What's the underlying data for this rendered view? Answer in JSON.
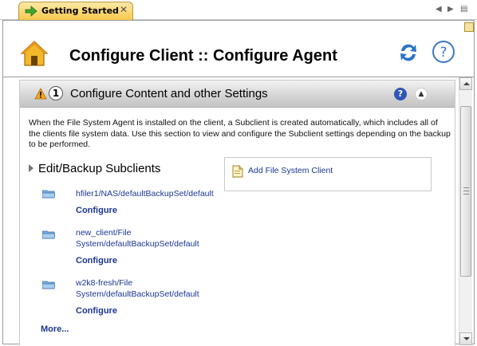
{
  "tab": {
    "label": "Getting Started",
    "close": "✕"
  },
  "tabnav": {
    "prev": "◀",
    "next": "▶",
    "menu": "▤"
  },
  "header": {
    "title": "Configure Client :: Configure Agent"
  },
  "section": {
    "number": "1",
    "title": "Configure Content and other Settings",
    "help": "?",
    "collapse": "▲",
    "description": "When the File System Agent is installed on the client, a Subclient is created automatically, which includes all of the clients file system data. Use this section to view and configure the Subclient settings depending on the backup to be performed."
  },
  "subclients": {
    "heading": "Edit/Backup Subclients",
    "items": [
      {
        "path": "hfiler1/NAS/defaultBackupSet/default",
        "action": "Configure"
      },
      {
        "path": "new_client/File System/defaultBackupSet/default",
        "action": "Configure"
      },
      {
        "path": "w2k8-fresh/File System/defaultBackupSet/default",
        "action": "Configure"
      }
    ],
    "more": "More..."
  },
  "add_client": {
    "label": "Add File System Client"
  },
  "icons": {
    "tab": "green-arrow-icon",
    "home": "home-icon",
    "refresh": "refresh-icon",
    "help": "help-icon",
    "warning": "warning-icon",
    "folder": "folder-icon",
    "document": "document-icon"
  },
  "colors": {
    "link": "#1b3694",
    "tab_active": "#f7c84c",
    "refresh": "#2b74c7"
  }
}
